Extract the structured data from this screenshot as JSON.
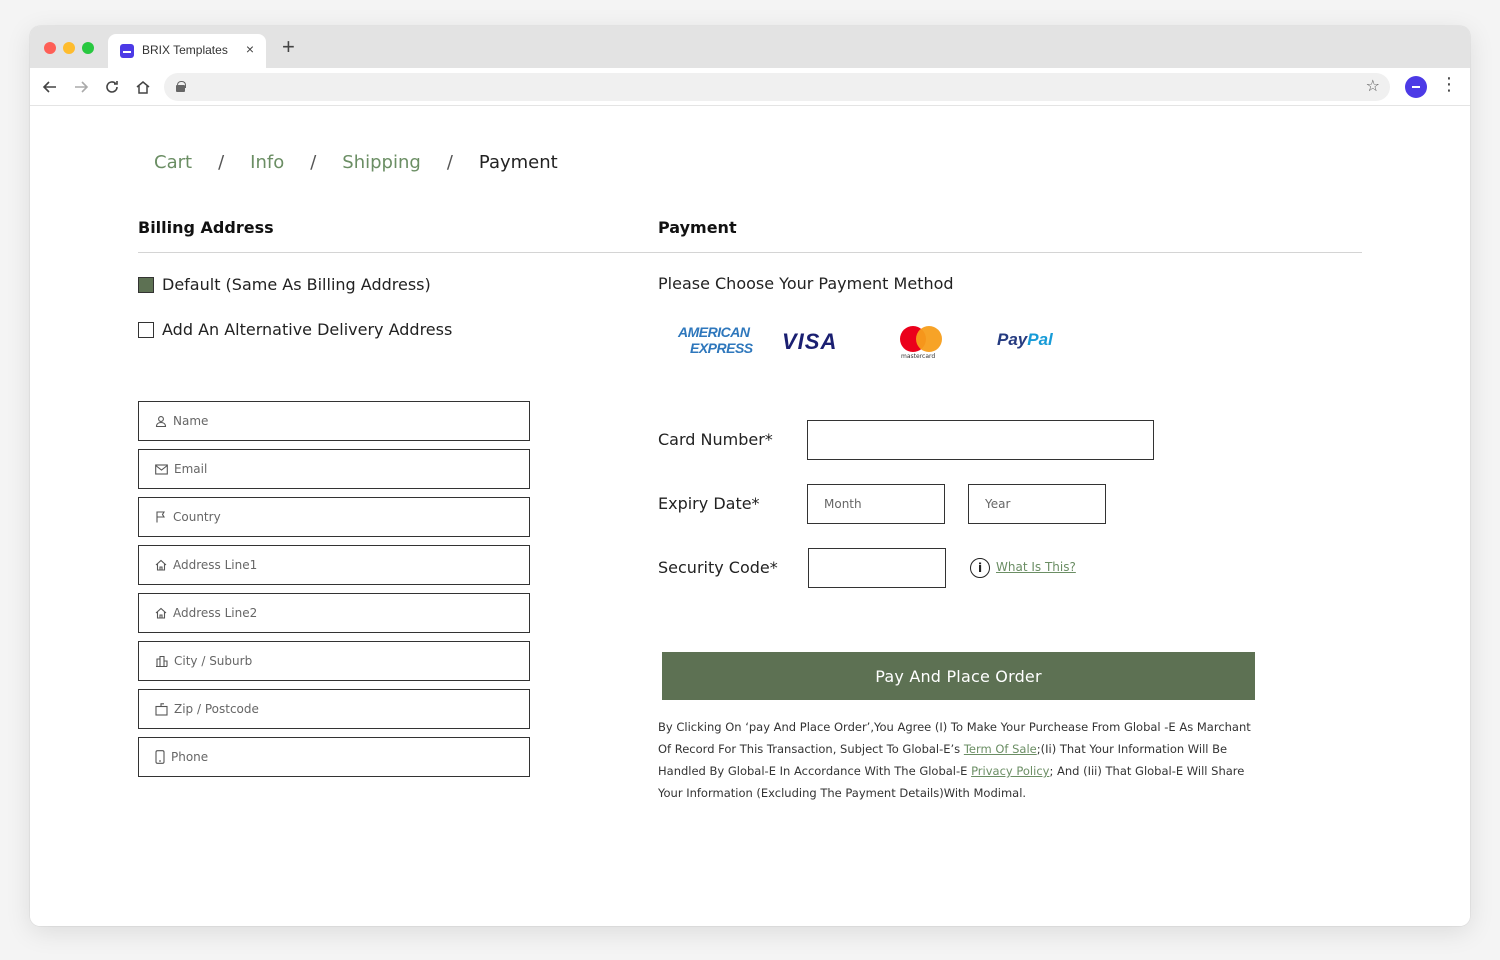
{
  "browser": {
    "tab_title": "BRIX Templates",
    "tab_close": "×",
    "new_tab": "+"
  },
  "breadcrumb": {
    "items": [
      {
        "label": "Cart"
      },
      {
        "label": "Info"
      },
      {
        "label": "Shipping"
      },
      {
        "label": "Payment"
      }
    ],
    "separator": "/"
  },
  "billing": {
    "title": "Billing Address",
    "options": [
      {
        "label": "Default (Same As Billing Address)",
        "checked": true
      },
      {
        "label": "Add An Alternative Delivery Address",
        "checked": false
      }
    ],
    "fields": [
      {
        "placeholder": "Name",
        "icon": "user-icon"
      },
      {
        "placeholder": "Email",
        "icon": "mail-icon"
      },
      {
        "placeholder": "Country",
        "icon": "flag-icon"
      },
      {
        "placeholder": "Address Line1",
        "icon": "home-icon"
      },
      {
        "placeholder": "Address Line2",
        "icon": "home-icon"
      },
      {
        "placeholder": "City / Suburb",
        "icon": "building-icon"
      },
      {
        "placeholder": "Zip / Postcode",
        "icon": "mailbox-icon"
      },
      {
        "placeholder": "Phone",
        "icon": "phone-icon"
      }
    ]
  },
  "payment": {
    "title": "Payment",
    "subtitle": "Please Choose Your Payment Method",
    "methods": {
      "amex_line1": "AMERICAN",
      "amex_line2": "EXPRESS",
      "visa": "VISA",
      "mastercard": "mastercard",
      "paypal_part1": "Pay",
      "paypal_part2": "Pal"
    },
    "card_number_label": "Card Number*",
    "expiry_label": "Expiry Date*",
    "month_placeholder": "Month",
    "year_placeholder": "Year",
    "security_label": "Security Code*",
    "info_icon_glyph": "i",
    "what_is_this": "What Is This?",
    "submit_label": "Pay And Place Order",
    "legal": {
      "part1": "By Clicking On ‘pay And Place Order’,You Agree (I) To Make Your Purchease From Global -E As Marchant Of Record For This Transaction, Subject To Global-E’s ",
      "term_link": " Term Of Sale",
      "part2": ";(Ii) That Your Information Will Be Handled By Global-E In Accordance With The Global-E ",
      "privacy_link": "Privacy Policy",
      "part3": "; And (Iii) That Global-E Will Share Your Information (Excluding The Payment Details)With Modimal."
    }
  },
  "colors": {
    "accent": "#5d7153",
    "link": "#6b8e64",
    "brand": "#4c3ae6"
  }
}
